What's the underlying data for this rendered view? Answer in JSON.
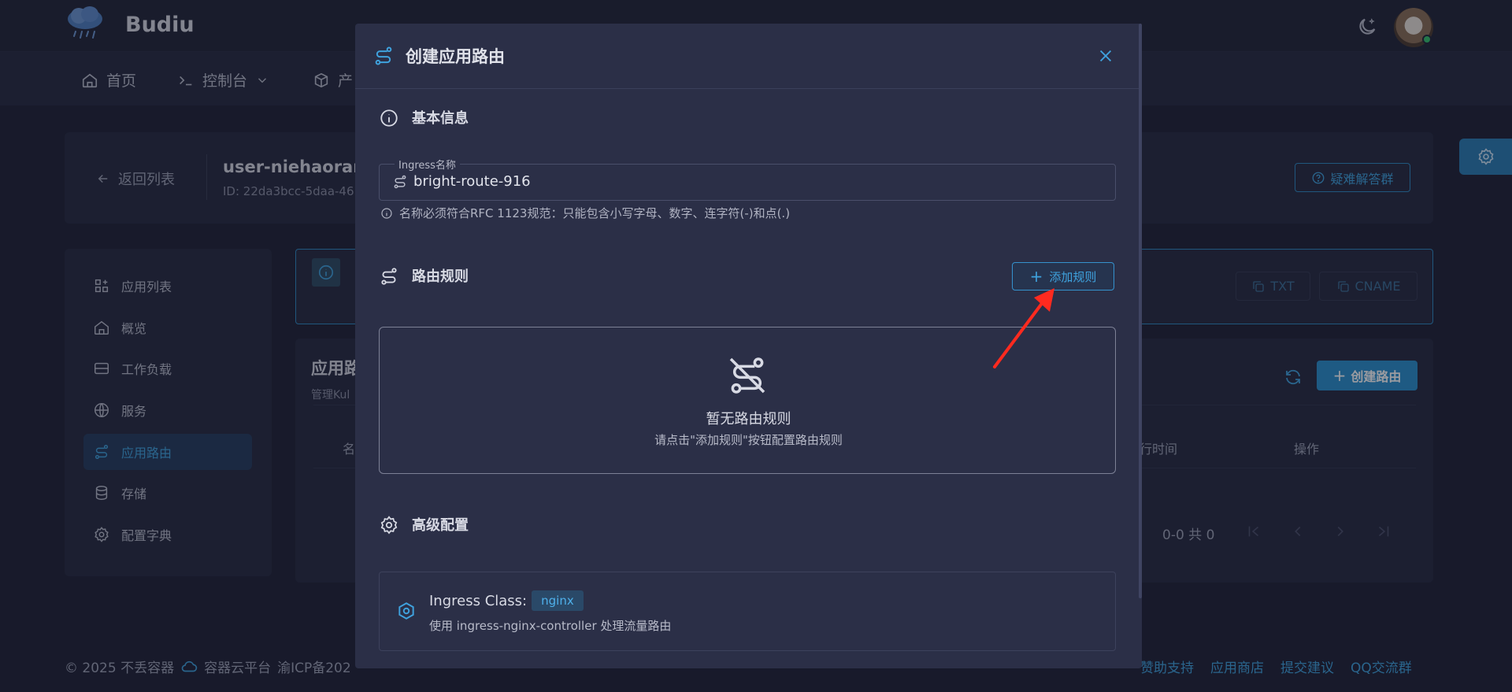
{
  "app": {
    "brand": "Budiu"
  },
  "nav": {
    "home": "首页",
    "console": "控制台",
    "products": "产"
  },
  "header": {
    "back": "返回列表",
    "app_name": "user-niehaoran-",
    "app_id": "ID: 22da3bcc-5daa-46",
    "help": "疑难解答群"
  },
  "sidebar": {
    "items": [
      {
        "label": "应用列表",
        "icon": "apps-icon"
      },
      {
        "label": "概览",
        "icon": "home-icon"
      },
      {
        "label": "工作负载",
        "icon": "workload-icon"
      },
      {
        "label": "服务",
        "icon": "globe-icon"
      },
      {
        "label": "应用路由",
        "icon": "route-icon"
      },
      {
        "label": "存储",
        "icon": "database-icon"
      },
      {
        "label": "配置字典",
        "icon": "gear-icon"
      }
    ]
  },
  "alert": {
    "txt_btn": "TXT",
    "cname_btn": "CNAME"
  },
  "table": {
    "title": "应用路",
    "subtitle": "管理Kul",
    "create_btn": "创建路由",
    "col_name": "名",
    "col_time": "行时间",
    "col_ops": "操作",
    "pager": "0-0 共 0"
  },
  "footer": {
    "copyright": "© 2025 不丢容器",
    "platform": "容器云平台",
    "icp": "渝ICP备202",
    "links": [
      "赞助支持",
      "应用商店",
      "提交建议",
      "QQ交流群"
    ]
  },
  "modal": {
    "title": "创建应用路由",
    "basic_section": "基本信息",
    "field_label": "Ingress名称",
    "field_value": "bright-route-916",
    "hint": "名称必须符合RFC 1123规范：只能包含小写字母、数字、连字符(-)和点(.)",
    "rules_section": "路由规则",
    "add_rule": "添加规则",
    "empty_title": "暂无路由规则",
    "empty_sub": "请点击\"添加规则\"按钮配置路由规则",
    "advanced_section": "高级配置",
    "class_label": "Ingress Class:",
    "class_value": "nginx",
    "class_desc": "使用 ingress-nginx-controller 处理流量路由"
  },
  "colors": {
    "accent": "#3fa2de",
    "arrow": "#ff2a1f",
    "modal_bg": "#2b2f47",
    "page_bg": "#1f2236"
  }
}
